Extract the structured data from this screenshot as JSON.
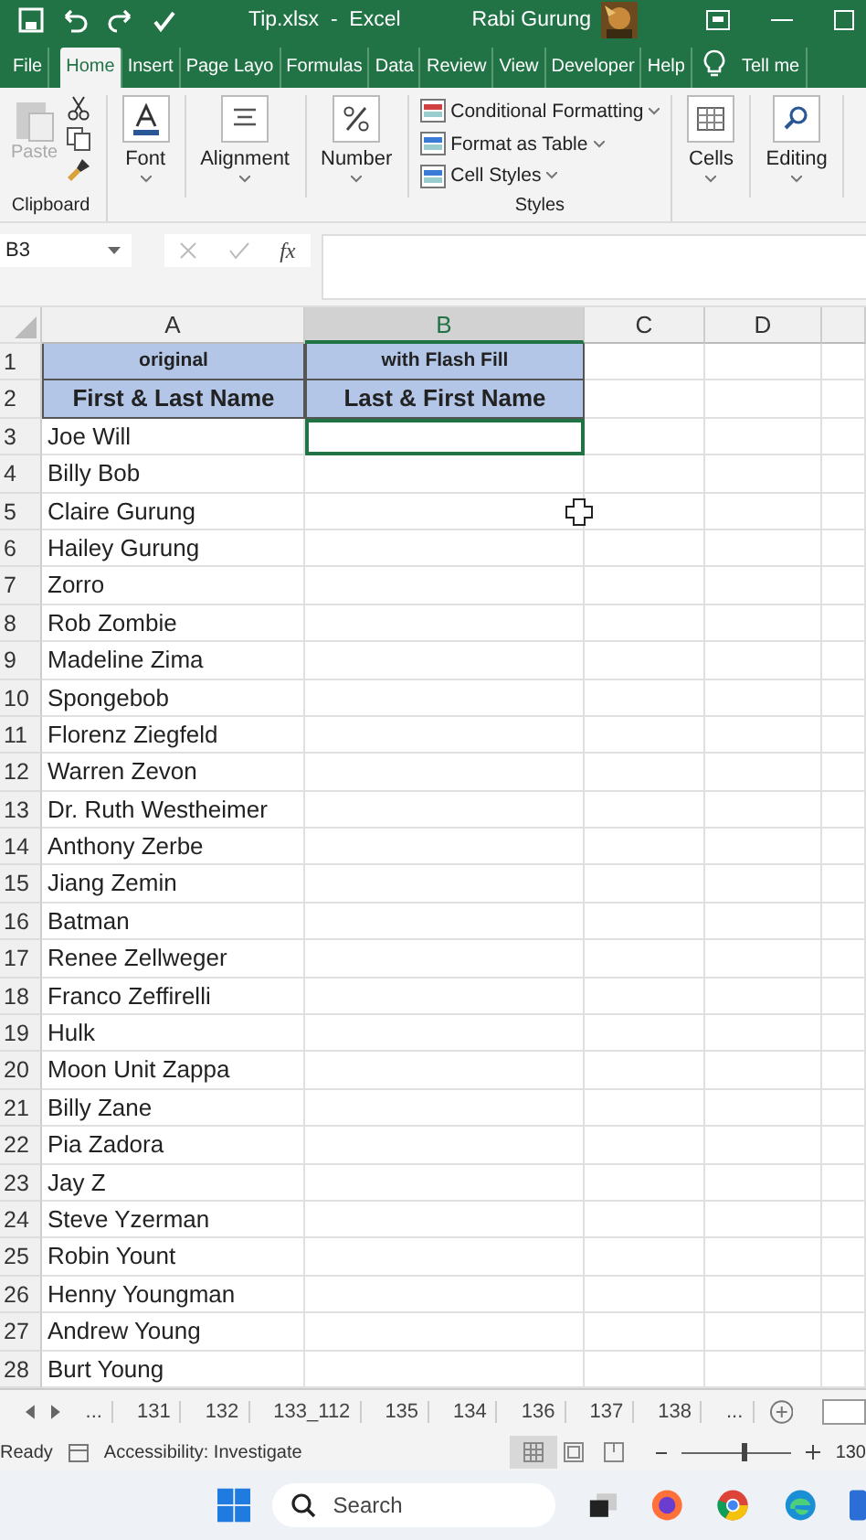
{
  "title_bar": {
    "title": "Tip.xlsx  -  Excel",
    "user": "Rabi Gurung"
  },
  "ribbon_tabs": [
    {
      "label": "File",
      "selected": false
    },
    {
      "label": "Home",
      "selected": true
    },
    {
      "label": "Insert",
      "selected": false
    },
    {
      "label": "Page Layo",
      "selected": false
    },
    {
      "label": "Formulas",
      "selected": false
    },
    {
      "label": "Data",
      "selected": false
    },
    {
      "label": "Review",
      "selected": false
    },
    {
      "label": "View",
      "selected": false
    },
    {
      "label": "Developer",
      "selected": false
    },
    {
      "label": "Help",
      "selected": false
    }
  ],
  "tell_me": "Tell me",
  "ribbon": {
    "paste": {
      "label": "Paste",
      "disabled": true
    },
    "clipboard": "Clipboard",
    "font": "Font",
    "alignment": "Alignment",
    "number": "Number",
    "styles_items": [
      "Conditional Formatting",
      "Format as Table",
      "Cell Styles"
    ],
    "styles": "Styles",
    "cells": "Cells",
    "editing": "Editing"
  },
  "formula_bar": {
    "name_box": "B3",
    "function_symbol": "fx"
  },
  "columns": [
    {
      "label": "A",
      "selected": false
    },
    {
      "label": "B",
      "selected": true
    },
    {
      "label": "C",
      "selected": false
    },
    {
      "label": "D",
      "selected": false
    }
  ],
  "rows": [
    {
      "number": "1",
      "kind": "title",
      "a": "original",
      "b": "with Flash Fill",
      "selected": false
    },
    {
      "number": "2",
      "kind": "header",
      "a": "First & Last Name",
      "b": "Last & First Name",
      "selected": false
    },
    {
      "number": "3",
      "kind": "data",
      "a": "Joe Will",
      "selected": true
    },
    {
      "number": "4",
      "kind": "data",
      "a": "Billy Bob",
      "selected": false
    },
    {
      "number": "5",
      "kind": "data",
      "a": "Claire Gurung",
      "selected": false
    },
    {
      "number": "6",
      "kind": "data",
      "a": "Hailey Gurung",
      "selected": false
    },
    {
      "number": "7",
      "kind": "data",
      "a": "Zorro",
      "selected": false
    },
    {
      "number": "8",
      "kind": "data",
      "a": "Rob Zombie",
      "selected": false
    },
    {
      "number": "9",
      "kind": "data",
      "a": "Madeline Zima",
      "selected": false
    },
    {
      "number": "10",
      "kind": "data",
      "a": "Spongebob",
      "selected": false
    },
    {
      "number": "11",
      "kind": "data",
      "a": "Florenz Ziegfeld",
      "selected": false
    },
    {
      "number": "12",
      "kind": "data",
      "a": "Warren Zevon",
      "selected": false
    },
    {
      "number": "13",
      "kind": "data",
      "a": "Dr. Ruth Westheimer",
      "selected": false
    },
    {
      "number": "14",
      "kind": "data",
      "a": "Anthony Zerbe",
      "selected": false
    },
    {
      "number": "15",
      "kind": "data",
      "a": "Jiang Zemin",
      "selected": false
    },
    {
      "number": "16",
      "kind": "data",
      "a": "Batman",
      "selected": false
    },
    {
      "number": "17",
      "kind": "data",
      "a": "Renee Zellweger",
      "selected": false
    },
    {
      "number": "18",
      "kind": "data",
      "a": "Franco Zeffirelli",
      "selected": false
    },
    {
      "number": "19",
      "kind": "data",
      "a": "Hulk",
      "selected": false
    },
    {
      "number": "20",
      "kind": "data",
      "a": "Moon Unit Zappa",
      "selected": false
    },
    {
      "number": "21",
      "kind": "data",
      "a": "Billy Zane",
      "selected": false
    },
    {
      "number": "22",
      "kind": "data",
      "a": "Pia Zadora",
      "selected": false
    },
    {
      "number": "23",
      "kind": "data",
      "a": "Jay Z",
      "selected": false
    },
    {
      "number": "24",
      "kind": "data",
      "a": "Steve Yzerman",
      "selected": false
    },
    {
      "number": "25",
      "kind": "data",
      "a": "Robin Yount",
      "selected": false
    },
    {
      "number": "26",
      "kind": "data",
      "a": "Henny Youngman",
      "selected": false
    },
    {
      "number": "27",
      "kind": "data",
      "a": "Andrew Young",
      "selected": false
    },
    {
      "number": "28",
      "kind": "data",
      "a": "Burt Young",
      "selected": false
    }
  ],
  "sheet_tabs": [
    "...",
    "131",
    "132",
    "133_112",
    "135",
    "134",
    "136",
    "137",
    "138",
    "..."
  ],
  "status_bar": {
    "status": "Ready",
    "accessibility": "Accessibility: Investigate",
    "zoom": "130",
    "zoom_slider": {
      "level": 0.55
    }
  },
  "taskbar": {
    "search": "Search"
  }
}
